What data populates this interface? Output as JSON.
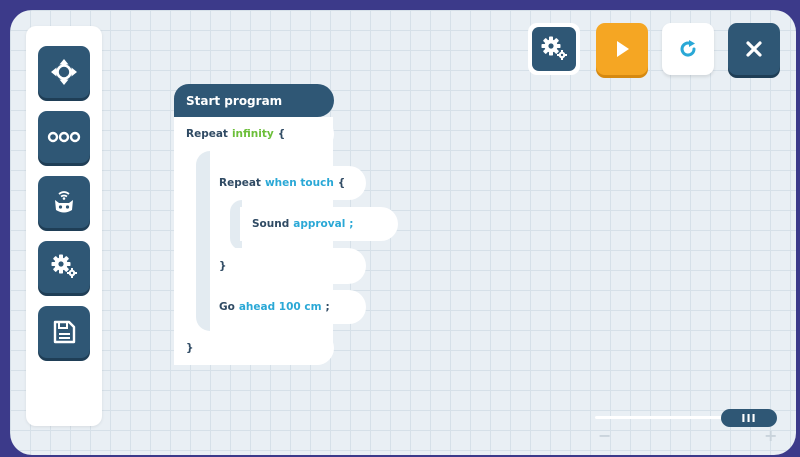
{
  "app": {
    "accent": "#2f5775",
    "play_color": "#f5a623",
    "background": "#e9eff4"
  },
  "sidebar": {
    "items": [
      {
        "name": "dpad-icon"
      },
      {
        "name": "dots-icon"
      },
      {
        "name": "robot-icon"
      },
      {
        "name": "settings-icon"
      },
      {
        "name": "save-icon"
      }
    ]
  },
  "toolbar": {
    "settings_icon": "gear-icon",
    "play_icon": "play-icon",
    "reset_icon": "reset-icon",
    "close_icon": "close-icon"
  },
  "program": {
    "start_label": "Start program",
    "outer_repeat": {
      "keyword": "Repeat",
      "arg": "infinity",
      "open": "{"
    },
    "inner_repeat": {
      "keyword": "Repeat",
      "arg": "when touch",
      "open": "{"
    },
    "sound": {
      "keyword": "Sound",
      "arg": "approval",
      "end": ";"
    },
    "inner_close": "}",
    "go": {
      "keyword": "Go",
      "arg": "ahead 100 cm",
      "end": ";"
    },
    "outer_close": "}"
  },
  "zoom": {
    "thumb_label": "III",
    "minus": "−",
    "plus": "+",
    "level": 0.92
  }
}
